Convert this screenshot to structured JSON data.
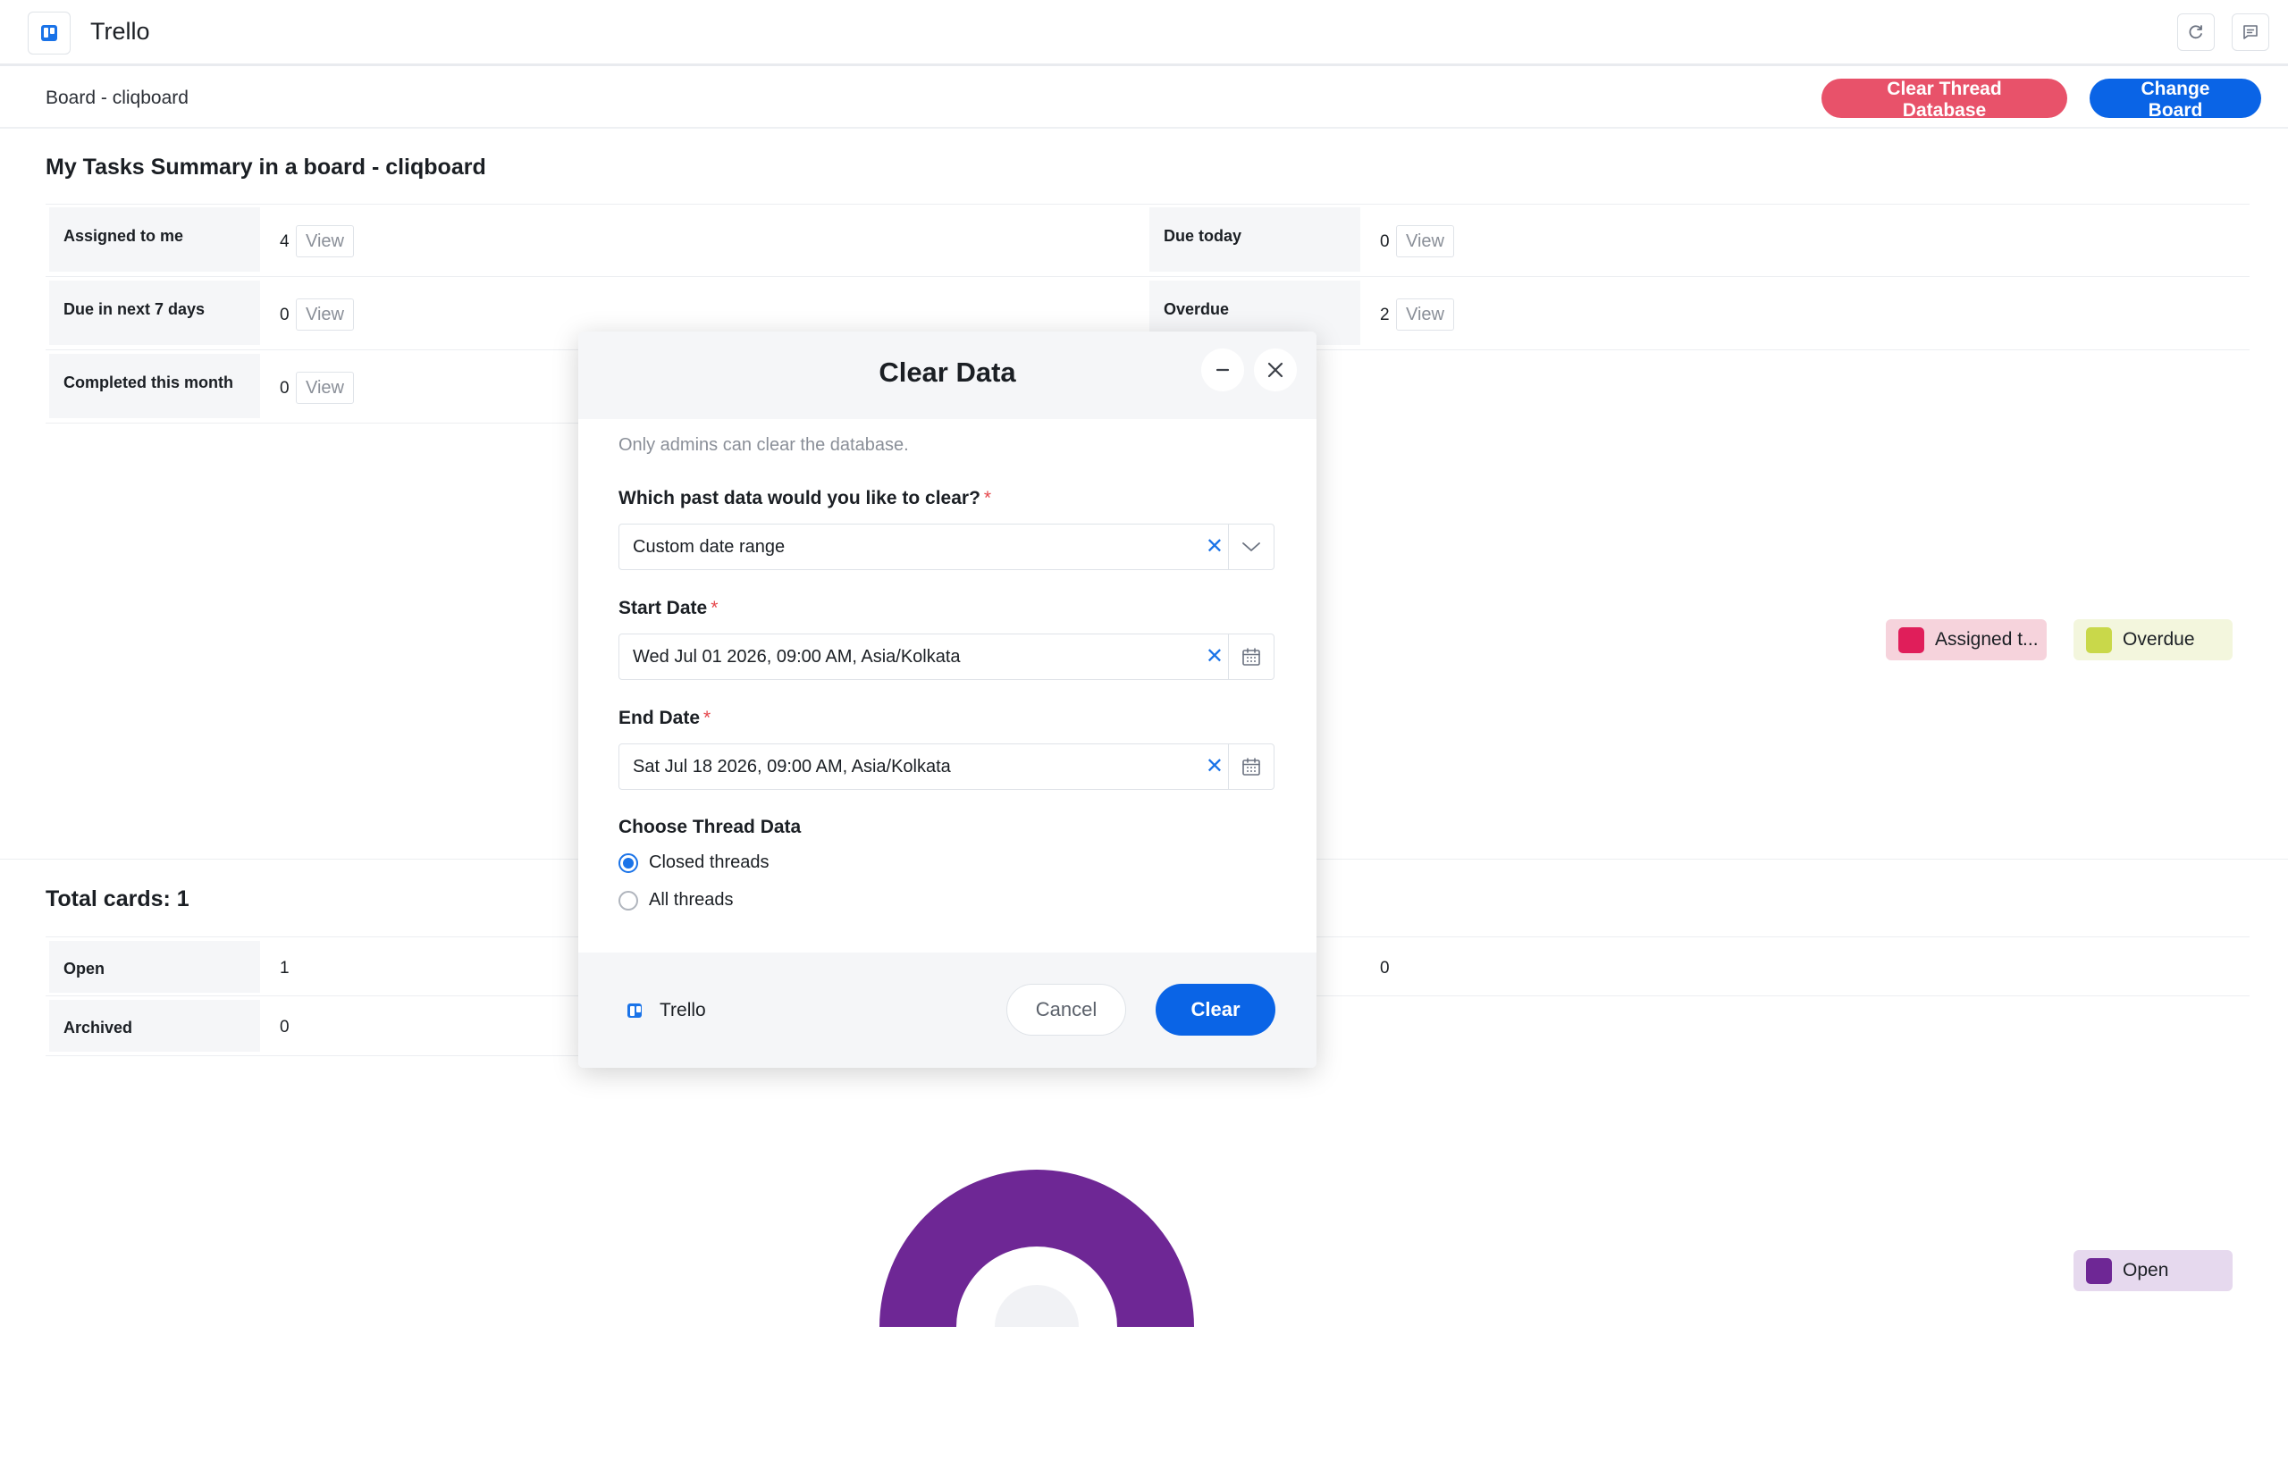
{
  "app": {
    "title": "Trello"
  },
  "header": {
    "refresh_icon": "refresh-icon",
    "chat_icon": "message-icon"
  },
  "subbar": {
    "board_label": "Board - cliqboard",
    "clear_db_label": "Clear Thread Database",
    "change_board_label": "Change Board"
  },
  "summary": {
    "title": "My Tasks Summary in a board - cliqboard",
    "view_label": "View",
    "left": [
      {
        "label": "Assigned to me",
        "value": "4"
      },
      {
        "label": "Due in next 7 days",
        "value": "0"
      },
      {
        "label": "Completed this month",
        "value": "0"
      }
    ],
    "right": [
      {
        "label": "Due today",
        "value": "0"
      },
      {
        "label": "Overdue",
        "value": "2"
      }
    ],
    "legend": [
      {
        "label": "Assigned t...",
        "color": "#e01e5a",
        "bg": "#f6d3dc"
      },
      {
        "label": "Overdue",
        "color": "#c9d84a",
        "bg": "#f3f6dd"
      }
    ]
  },
  "total_cards": {
    "title": "Total cards: 1",
    "rows": [
      {
        "label": "Open",
        "value": "1"
      },
      {
        "label": "Archived",
        "value": "0"
      }
    ],
    "right_value": "0",
    "legend": [
      {
        "label": "Open",
        "color": "#6e2795",
        "bg": "#e6d9ee"
      }
    ]
  },
  "modal": {
    "title": "Clear Data",
    "note": "Only admins can clear the database.",
    "q_label": "Which past data would you like to clear?",
    "q_value": "Custom date range",
    "start_label": "Start Date",
    "start_value": "Wed Jul 01 2026, 09:00 AM, Asia/Kolkata",
    "end_label": "End Date",
    "end_value": "Sat Jul 18 2026, 09:00 AM, Asia/Kolkata",
    "thread_label": "Choose Thread Data",
    "options": [
      {
        "label": "Closed threads",
        "selected": true
      },
      {
        "label": "All threads",
        "selected": false
      }
    ],
    "footer_brand": "Trello",
    "cancel_label": "Cancel",
    "clear_label": "Clear"
  }
}
